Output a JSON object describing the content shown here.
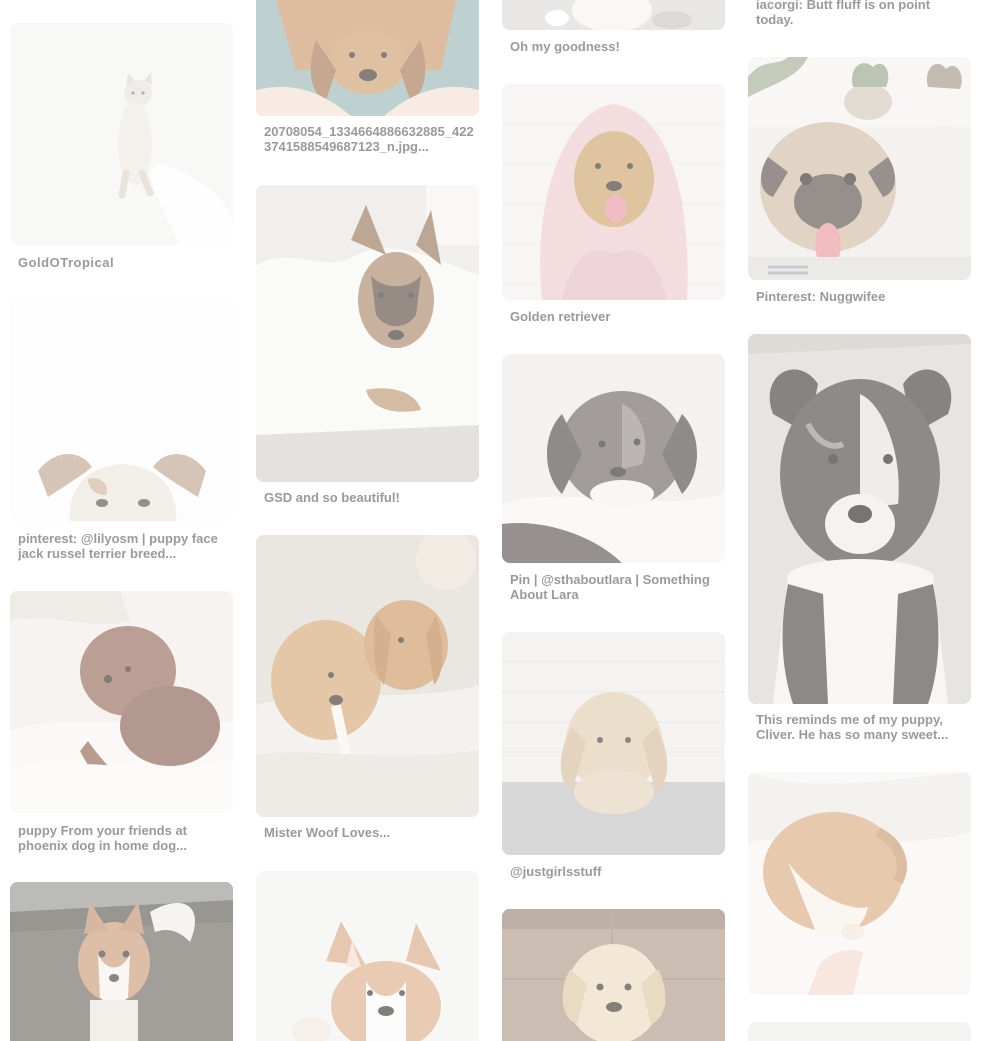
{
  "pins": [
    {
      "id": "kitten",
      "caption": "GoldOTropical",
      "palette": [
        "#f4f4f4",
        "#e3ded8",
        "#cfc7bd"
      ]
    },
    {
      "id": "terrier",
      "caption": "pinterest: @lilyosm | puppy face jack russel terrier breed...",
      "palette": [
        "#fafafa",
        "#e6ddd1",
        "#b69a84"
      ]
    },
    {
      "id": "brown-poodle",
      "caption": "puppy From your friends at phoenix dog in home dog...",
      "palette": [
        "#efeae4",
        "#9b6f5b",
        "#6a4235"
      ]
    },
    {
      "id": "husky",
      "caption": "",
      "palette": [
        "#6e6a60",
        "#c99a77",
        "#f2efe9"
      ]
    },
    {
      "id": "golden-lap",
      "caption": "20708054_1334664886632885_4223741588549687123_n.jpg...",
      "palette": [
        "#9cb8b6",
        "#c9986c",
        "#f1ddd0"
      ]
    },
    {
      "id": "gsd-blanket",
      "caption": "GSD and so beautiful!",
      "palette": [
        "#e9e8e4",
        "#f7f6f3",
        "#a57c5c"
      ]
    },
    {
      "id": "golden-pair",
      "caption": "Mister Woof Loves...",
      "palette": [
        "#dcd7cf",
        "#d4a36d",
        "#ece8e1"
      ]
    },
    {
      "id": "corgi",
      "caption": "",
      "palette": [
        "#f1f1ef",
        "#d8a57a",
        "#fafafa"
      ]
    },
    {
      "id": "white-pup",
      "caption": "Oh my goodness!",
      "palette": [
        "#dfdcd8",
        "#f4f2ef",
        "#c7c1ba"
      ]
    },
    {
      "id": "golden-towel",
      "caption": "Golden retriever",
      "palette": [
        "#f2f1ef",
        "#e9c3c8",
        "#c9985d"
      ]
    },
    {
      "id": "merle-pup",
      "caption": "Pin | @sthaboutlara | Something About Lara",
      "palette": [
        "#ebe8e4",
        "#6a625e",
        "#f6f4f1"
      ]
    },
    {
      "id": "bunny",
      "caption": "@justgirlsstuff",
      "palette": [
        "#eceae6",
        "#d9c2a2",
        "#bdbcbb"
      ]
    },
    {
      "id": "golden-puppy",
      "caption": "",
      "palette": [
        "#a88f7c",
        "#e8d3b4",
        "#7d6b5d"
      ]
    },
    {
      "id": "corgi-butt",
      "caption": "iacorgi: Butt fluff is on point today.",
      "palette": []
    },
    {
      "id": "pug",
      "caption": "Pinterest: Nuggwifee",
      "palette": [
        "#e9e7e2",
        "#cdb9a0",
        "#5a4e44"
      ]
    },
    {
      "id": "aussie-pup",
      "caption": "This reminds me of my puppy, Cliver. He has so many sweet...",
      "palette": [
        "#d9d5cf",
        "#3e3936",
        "#f2f0ec"
      ]
    },
    {
      "id": "sleeping-pup",
      "caption": "",
      "palette": [
        "#f6f4f2",
        "#d9a878",
        "#efe3d6"
      ]
    },
    {
      "id": "partial",
      "caption": "",
      "palette": [
        "#eeeeec",
        "#e2e0dc",
        "#d8d5d0"
      ]
    }
  ],
  "caption_color": "#9a9a9a"
}
